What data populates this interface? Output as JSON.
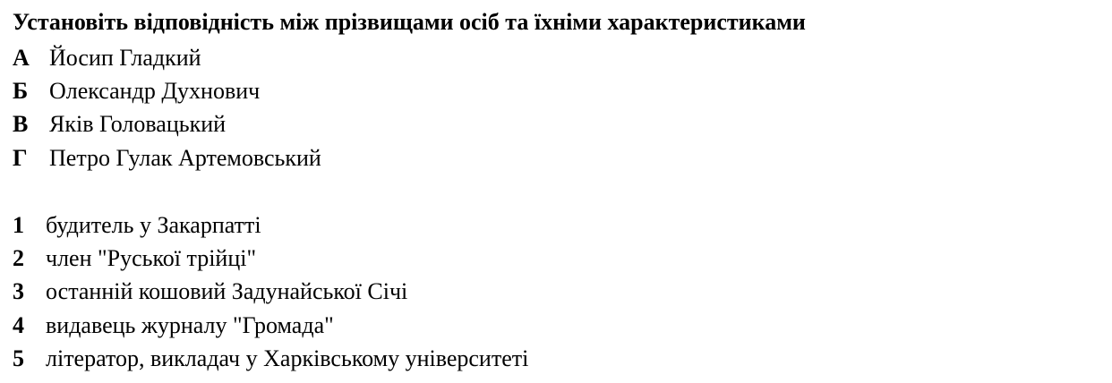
{
  "question": {
    "title": "Установіть відповідність між прізвищами осіб та їхніми характеристиками"
  },
  "people": [
    {
      "key": "А",
      "text": "Йосип Гладкий"
    },
    {
      "key": "Б",
      "text": "Олександр Духнович"
    },
    {
      "key": "В",
      "text": "Яків Головацький"
    },
    {
      "key": "Г",
      "text": "Петро Гулак Артемовський"
    }
  ],
  "traits": [
    {
      "key": "1",
      "text": "будитель у Закарпатті"
    },
    {
      "key": "2",
      "text": "член \"Руської трійці\""
    },
    {
      "key": "3",
      "text": "останній кошовий Задунайської Січі"
    },
    {
      "key": "4",
      "text": "видавець журналу \"Громада\""
    },
    {
      "key": "5",
      "text": "літератор, викладач у Харківському університеті"
    }
  ]
}
